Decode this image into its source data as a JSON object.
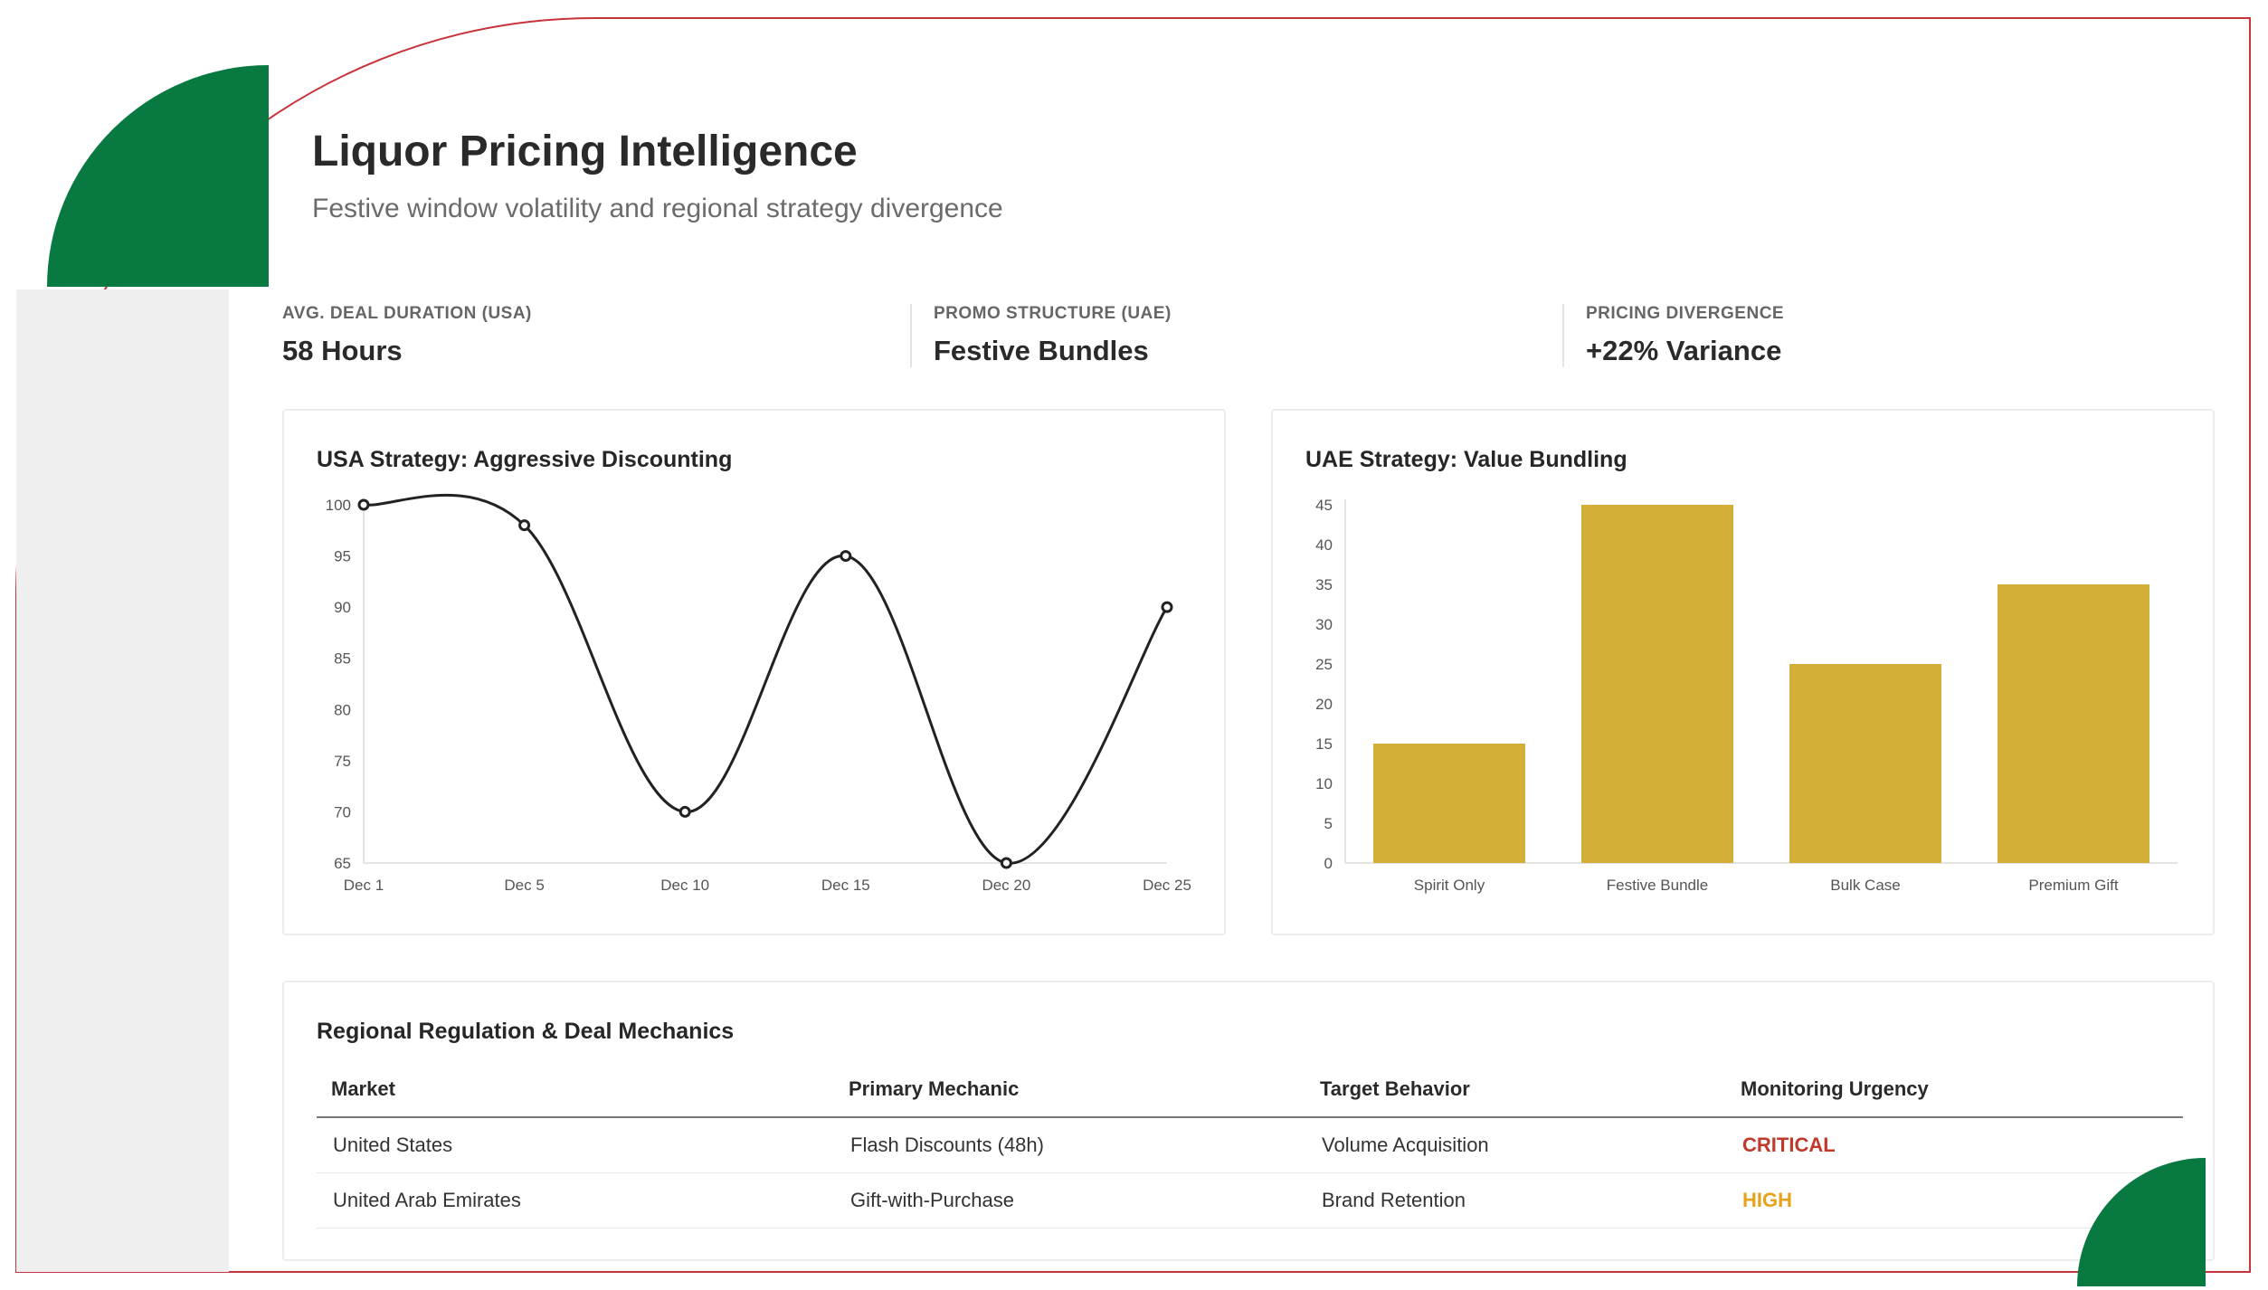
{
  "header": {
    "title": "Liquor Pricing Intelligence",
    "subtitle": "Festive window volatility and regional strategy divergence"
  },
  "kpis": [
    {
      "label": "AVG. DEAL DURATION (USA)",
      "value": "58 Hours"
    },
    {
      "label": "PROMO STRUCTURE (UAE)",
      "value": "Festive Bundles"
    },
    {
      "label": "PRICING DIVERGENCE",
      "value": "+22% Variance"
    }
  ],
  "colors": {
    "brand_green": "#087a41",
    "frame_red": "#c8323a",
    "bar_gold": "#d4af37",
    "line_dark": "#222222",
    "critical_red": "#c0392b",
    "high_amber": "#e6a21a"
  },
  "chart_data": [
    {
      "type": "line",
      "title": "USA Strategy: Aggressive Discounting",
      "x": [
        "Dec 1",
        "Dec 5",
        "Dec 10",
        "Dec 15",
        "Dec 20",
        "Dec 25"
      ],
      "series": [
        {
          "values": [
            100,
            98,
            70,
            95,
            65,
            90
          ]
        }
      ],
      "yticks": [
        65,
        70,
        75,
        80,
        85,
        90,
        95,
        100
      ],
      "ylim": [
        65,
        100
      ],
      "grid": false,
      "legend": "none"
    },
    {
      "type": "bar",
      "title": "UAE Strategy: Value Bundling",
      "categories": [
        "Spirit Only",
        "Festive Bundle",
        "Bulk Case",
        "Premium Gift"
      ],
      "values": [
        15,
        45,
        25,
        35
      ],
      "yticks": [
        0,
        5,
        10,
        15,
        20,
        25,
        30,
        35,
        40,
        45
      ],
      "ylim": [
        0,
        45
      ],
      "grid": false,
      "legend": "none"
    }
  ],
  "table": {
    "title": "Regional Regulation & Deal Mechanics",
    "columns": [
      "Market",
      "Primary Mechanic",
      "Target Behavior",
      "Monitoring Urgency"
    ],
    "rows": [
      {
        "market": "United States",
        "mechanic": "Flash Discounts (48h)",
        "behavior": "Volume Acquisition",
        "urgency": "CRITICAL",
        "urgency_color": "#c0392b"
      },
      {
        "market": "United Arab Emirates",
        "mechanic": "Gift-with-Purchase",
        "behavior": "Brand Retention",
        "urgency": "HIGH",
        "urgency_color": "#e6a21a"
      }
    ]
  }
}
